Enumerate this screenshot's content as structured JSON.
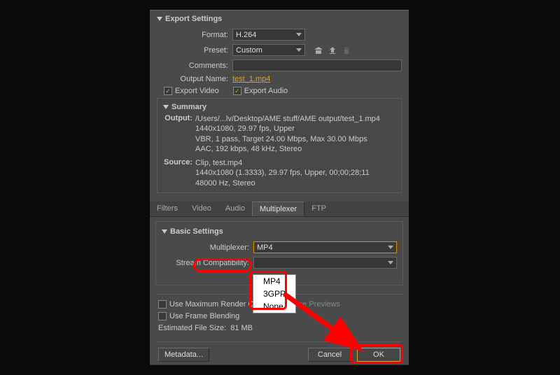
{
  "export_settings": {
    "title": "Export Settings",
    "format_label": "Format:",
    "format_value": "H.264",
    "preset_label": "Preset:",
    "preset_value": "Custom",
    "comments_label": "Comments:",
    "comments_value": "",
    "output_name_label": "Output Name:",
    "output_name_value": "test_1.mp4",
    "export_video_label": "Export Video",
    "export_audio_label": "Export Audio"
  },
  "summary": {
    "title": "Summary",
    "output_key": "Output:",
    "output_lines": [
      "/Users/...lv/Desktop/AME stuff/AME output/test_1.mp4",
      "1440x1080, 29.97 fps, Upper",
      "VBR, 1 pass, Target 24.00 Mbps, Max 30.00 Mbps",
      "AAC, 192 kbps, 48 kHz, Stereo"
    ],
    "source_key": "Source:",
    "source_lines": [
      "Clip, test.mp4",
      "1440x1080 (1.3333), 29.97 fps, Upper, 00;00;28;11",
      "48000 Hz, Stereo"
    ]
  },
  "tabs": {
    "filters": "Filters",
    "video": "Video",
    "audio": "Audio",
    "multiplexer": "Multiplexer",
    "ftp": "FTP",
    "active": "multiplexer"
  },
  "basic": {
    "title": "Basic Settings",
    "multiplexer_label": "Multiplexer:",
    "multiplexer_value": "MP4",
    "stream_label": "Stream Compatibility:",
    "stream_value": "",
    "options": [
      "MP4",
      "3GPP",
      "None"
    ]
  },
  "bottom": {
    "max_quality": "Use Maximum Render Quality",
    "use_previews": "Use Previews",
    "frame_blending": "Use Frame Blending",
    "est_size_label": "Estimated File Size:",
    "est_size_value": "81 MB"
  },
  "buttons": {
    "metadata": "Metadata...",
    "cancel": "Cancel",
    "ok": "OK"
  }
}
